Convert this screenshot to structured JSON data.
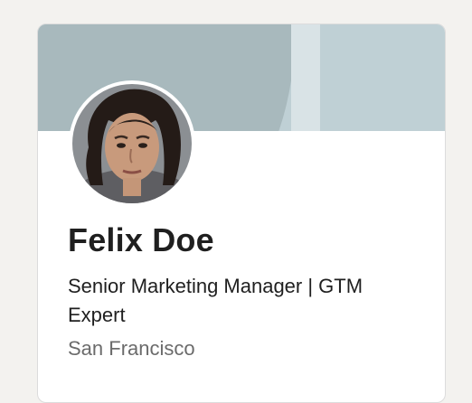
{
  "profile": {
    "name": "Felix Doe",
    "headline": "Senior Marketing Manager | GTM Expert",
    "location": "San Francisco"
  },
  "colors": {
    "background": "#f3f2ef",
    "cover": "#bfd0d5",
    "cover_arc": "#a8b9bd",
    "text_primary": "#1f1f1f",
    "text_secondary": "#6b6b6b"
  },
  "icons": {
    "avatar": "profile-photo"
  }
}
